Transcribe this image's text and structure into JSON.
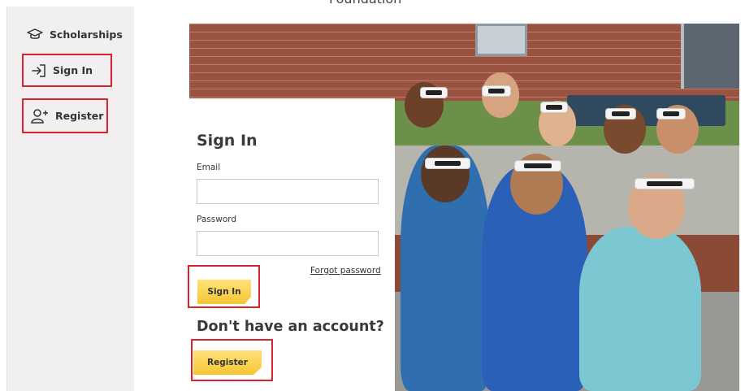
{
  "header": {
    "partial_title": "Foundation"
  },
  "sidebar": {
    "items": [
      {
        "label": "Scholarships",
        "icon": "graduation-cap-icon"
      },
      {
        "label": "Sign In",
        "icon": "sign-in-arrow-icon"
      },
      {
        "label": "Register",
        "icon": "user-plus-icon"
      }
    ]
  },
  "signin_form": {
    "title": "Sign In",
    "email_label": "Email",
    "email_value": "",
    "password_label": "Password",
    "password_value": "",
    "forgot_link": "Forgot password",
    "submit_label": "Sign In",
    "no_account_heading": "Don't have an account?",
    "register_label": "Register"
  },
  "hero": {
    "image_semantic": "children-wearing-eclipse-glasses-photo"
  },
  "colors": {
    "sidebar_bg": "#f1efef",
    "highlight_border": "#d62430",
    "button_gold": "#f5c632"
  }
}
